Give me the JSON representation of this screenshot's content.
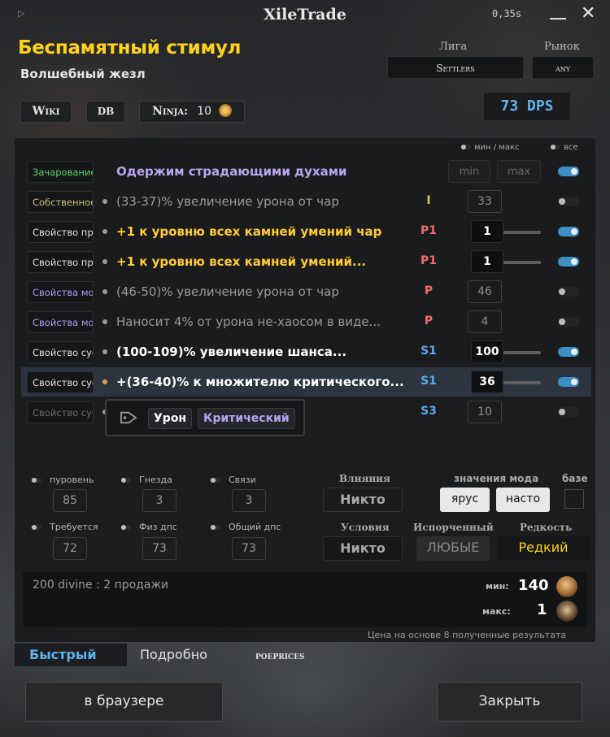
{
  "app": {
    "title": "XileTrade",
    "time": "0,35s"
  },
  "item": {
    "name": "Беспамятный стимул",
    "base": "Волшебный жезл"
  },
  "league": {
    "label": "Лига",
    "value": "Settlers"
  },
  "market": {
    "label": "Рынок",
    "value": "any"
  },
  "links": {
    "wiki": "Wiki",
    "db": "DB",
    "ninja": "Ninja:",
    "ninja_value": "10"
  },
  "dps": "73 DPS",
  "mod_headers": {
    "minmax": "мин / макс",
    "all": "все"
  },
  "enchant": {
    "source": "Зачарование",
    "text": "Одержим страдающими духами",
    "min": "min",
    "max": "max",
    "toggle": true,
    "color": "#b8a6f0",
    "source_color": "#5fd25f"
  },
  "mods": [
    {
      "source": "Собственное",
      "source_color": "#c9c27a",
      "text": "(33-37)% увеличение урона от чар",
      "tier": "I",
      "tier_color": "#d1c56a",
      "value": "33",
      "active": false,
      "bold": false,
      "text_color": "#9a9a9a",
      "bullet": "grey",
      "slider": false
    },
    {
      "source": "Свойство префикса",
      "source_color": "#e0e0e0",
      "text": "+1 к уровню всех камней умений чар",
      "tier": "P1",
      "tier_color": "#f06a6a",
      "value": "1",
      "active": true,
      "bold": true,
      "text_color": "#ffcc33",
      "bullet": "grey",
      "slider": true
    },
    {
      "source": "Свойство префикса",
      "source_color": "#e0e0e0",
      "text": "+1 к уровню всех камней умений...",
      "tier": "P1",
      "tier_color": "#f06a6a",
      "value": "1",
      "active": true,
      "bold": true,
      "text_color": "#ffcc33",
      "bullet": "grey",
      "slider": true
    },
    {
      "source": "Свойства мода",
      "source_color": "#a99cf0",
      "text": "(46-50)% увеличение урона от чар",
      "tier": "P",
      "tier_color": "#f06a6a",
      "value": "46",
      "active": false,
      "bold": false,
      "text_color": "#9a9a9a",
      "bullet": "grey",
      "slider": false
    },
    {
      "source": "Свойства мода",
      "source_color": "#a99cf0",
      "text": "Наносит 4% от урона не-хаосом в виде...",
      "tier": "P",
      "tier_color": "#f06a6a",
      "value": "4",
      "active": false,
      "bold": false,
      "text_color": "#9a9a9a",
      "bullet": "grey",
      "slider": false
    },
    {
      "source": "Свойство суффикса",
      "source_color": "#e0e0e0",
      "text": "(100-109)% увеличение шанса...",
      "tier": "S1",
      "tier_color": "#5aa9ef",
      "value": "100",
      "active": true,
      "bold": true,
      "text_color": "#ffffff",
      "bullet": "grey",
      "slider": true
    },
    {
      "source": "Свойство суффикса",
      "source_color": "#e0e0e0",
      "text": "+(36-40)% к множителю критического...",
      "tier": "S1",
      "tier_color": "#5aa9ef",
      "value": "36",
      "active": true,
      "bold": true,
      "text_color": "#ffffff",
      "bullet": "gold",
      "slider": true,
      "highlight": true
    },
    {
      "source": "Свойство суффикса",
      "source_color": "#6a6a6a",
      "text": "",
      "tier": "S3",
      "tier_color": "#5aa9ef",
      "value": "10",
      "active": false,
      "bold": false,
      "text_color": "#9a9a9a",
      "bullet": "grey",
      "slider": false
    }
  ],
  "tags": {
    "icon": "tag-icon",
    "tag1": "Урон",
    "tag2": "Критический"
  },
  "filters": {
    "ilvl": {
      "label": "пуровень",
      "value": "85"
    },
    "sockets": {
      "label": "Гнезда",
      "value": "3"
    },
    "links": {
      "label": "Связи",
      "value": "3"
    },
    "req": {
      "label": "Требуется",
      "value": "72"
    },
    "phys": {
      "label": "Физ дпс",
      "value": "73"
    },
    "total": {
      "label": "Общий дпс",
      "value": "73"
    }
  },
  "influence": {
    "label": "Влияния",
    "value": "Никто"
  },
  "modvalues": {
    "label": "значения мода",
    "tier_btn": "ярус",
    "real_btn": "насто"
  },
  "base_filter": {
    "label": "базе"
  },
  "conditions": {
    "label": "Условия",
    "value": "Никто"
  },
  "corrupted": {
    "label": "Испорченный",
    "value": "ЛЮБЫЕ"
  },
  "rarity": {
    "label": "Редкость",
    "value": "Редкий"
  },
  "price": {
    "summary": "200 divine : 2 продажи",
    "min_label": "мин:",
    "min_value": "140",
    "max_label": "макс:",
    "max_value": "1",
    "note": "Цена на основе 8 полученные результата"
  },
  "tabs": {
    "quick": "Быстрый",
    "detailed": "Подробно",
    "poeprices": "poeprices"
  },
  "buttons": {
    "browser": "в браузере",
    "close": "Закрыть"
  }
}
